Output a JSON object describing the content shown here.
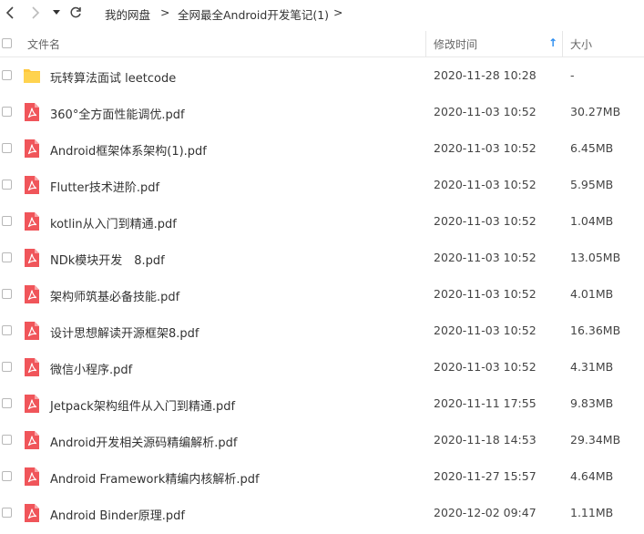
{
  "toolbar": {
    "breadcrumbs": [
      "我的网盘",
      "全网最全Android开发笔记(1)"
    ],
    "separator": ">"
  },
  "header": {
    "name": "文件名",
    "modified": "修改时间",
    "size": "大小",
    "sort_indicator": "↑"
  },
  "files": [
    {
      "type": "folder",
      "name": "玩转算法面试 leetcode",
      "date": "2020-11-28 10:28",
      "size": "-"
    },
    {
      "type": "pdf",
      "name": "360°全方面性能调优.pdf",
      "date": "2020-11-03 10:52",
      "size": "30.27MB"
    },
    {
      "type": "pdf",
      "name": "Android框架体系架构(1).pdf",
      "date": "2020-11-03 10:52",
      "size": "6.45MB"
    },
    {
      "type": "pdf",
      "name": "Flutter技术进阶.pdf",
      "date": "2020-11-03 10:52",
      "size": "5.95MB"
    },
    {
      "type": "pdf",
      "name": "kotlin从入门到精通.pdf",
      "date": "2020-11-03 10:52",
      "size": "1.04MB"
    },
    {
      "type": "pdf",
      "name": "NDk模块开发　8.pdf",
      "date": "2020-11-03 10:52",
      "size": "13.05MB"
    },
    {
      "type": "pdf",
      "name": "架构师筑基必备技能.pdf",
      "date": "2020-11-03 10:52",
      "size": "4.01MB"
    },
    {
      "type": "pdf",
      "name": "设计思想解读开源框架8.pdf",
      "date": "2020-11-03 10:52",
      "size": "16.36MB"
    },
    {
      "type": "pdf",
      "name": "微信小程序.pdf",
      "date": "2020-11-03 10:52",
      "size": "4.31MB"
    },
    {
      "type": "pdf",
      "name": "Jetpack架构组件从入门到精通.pdf",
      "date": "2020-11-11 17:55",
      "size": "9.83MB"
    },
    {
      "type": "pdf",
      "name": "Android开发相关源码精编解析.pdf",
      "date": "2020-11-18 14:53",
      "size": "29.34MB"
    },
    {
      "type": "pdf",
      "name": "Android Framework精编内核解析.pdf",
      "date": "2020-11-27 15:57",
      "size": "4.64MB"
    },
    {
      "type": "pdf",
      "name": "Android Binder原理.pdf",
      "date": "2020-12-02 09:47",
      "size": "1.11MB"
    }
  ],
  "colors": {
    "pdf_red": "#f0555a",
    "folder_yellow": "#ffc83d",
    "sort_blue": "#2a8cf0"
  }
}
